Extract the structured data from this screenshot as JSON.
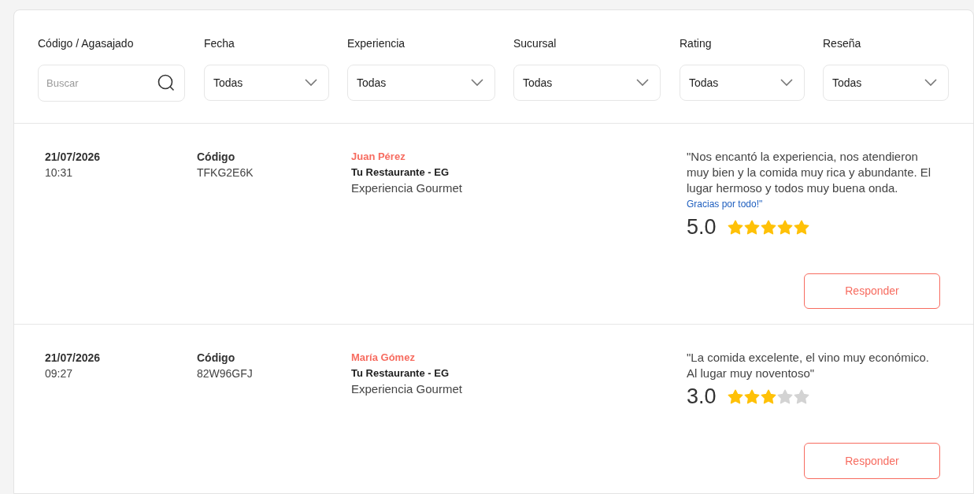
{
  "filters": [
    {
      "kind": "search",
      "label": "Código / Agasajado",
      "placeholder": "Buscar"
    },
    {
      "kind": "select",
      "label": "Fecha",
      "value": "Todas"
    },
    {
      "kind": "select",
      "label": "Experiencia",
      "value": "Todas"
    },
    {
      "kind": "select",
      "label": "Sucursal",
      "value": "Todas"
    },
    {
      "kind": "select",
      "label": "Rating",
      "value": "Todas"
    },
    {
      "kind": "select",
      "label": "Reseña",
      "value": "Todas"
    }
  ],
  "reviews": [
    {
      "date": "21/07/2026",
      "time": "10:31",
      "code_label": "Código",
      "code": "TFKG2E6K",
      "guest": "Juan Pérez",
      "branch": "Tu Restaurante - EG",
      "experience": "Experiencia Gourmet",
      "review": "\"Nos encantó la experiencia, nos atendieron muy bien y la comida muy rica y abundante. El lugar hermoso y todos muy buena onda.",
      "review_tail": "Gracias por todo!\"",
      "score": "5.0",
      "stars": 5,
      "action": "Responder"
    },
    {
      "date": "21/07/2026",
      "time": "09:27",
      "code_label": "Código",
      "code": "82W96GFJ",
      "guest": "María Gómez",
      "branch": "Tu Restaurante - EG",
      "experience": "Experiencia Gourmet",
      "review": "\"La comida excelente, el vino muy económico. Al lugar muy noventoso\"",
      "score": "3.0",
      "stars": 3,
      "action": "Responder"
    }
  ]
}
